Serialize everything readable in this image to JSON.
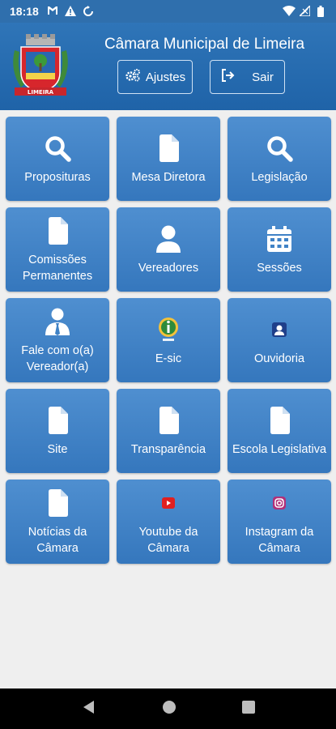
{
  "status_bar": {
    "time": "18:18",
    "left_icons": [
      "gmail-icon",
      "warning-icon",
      "sync-icon"
    ],
    "right_icons": [
      "wifi-icon",
      "signal-icon",
      "battery-icon"
    ]
  },
  "header": {
    "title": "Câmara Municipal de Limeira",
    "settings_label": "Ajustes",
    "exit_label": "Sair",
    "logo_text": "LIMEIRA"
  },
  "tiles": [
    {
      "label": "Proposituras",
      "icon": "search-icon"
    },
    {
      "label": "Mesa Diretora",
      "icon": "document-icon"
    },
    {
      "label": "Legislação",
      "icon": "search-icon"
    },
    {
      "label": "Comissões Permanentes",
      "icon": "document-icon"
    },
    {
      "label": "Vereadores",
      "icon": "user-icon"
    },
    {
      "label": "Sessões",
      "icon": "calendar-icon"
    },
    {
      "label": "Fale com o(a) Vereador(a)",
      "icon": "person-tie-icon"
    },
    {
      "label": "E-sic",
      "icon": "info-icon"
    },
    {
      "label": "Ouvidoria",
      "icon": "ouvidoria-icon"
    },
    {
      "label": "Site",
      "icon": "document-icon"
    },
    {
      "label": "Transparência",
      "icon": "document-icon"
    },
    {
      "label": "Escola Legislativa",
      "icon": "document-icon"
    },
    {
      "label": "Notícias da Câmara",
      "icon": "document-icon"
    },
    {
      "label": "Youtube da Câmara",
      "icon": "youtube-icon"
    },
    {
      "label": "Instagram da Câmara",
      "icon": "instagram-icon"
    }
  ],
  "nav_bar": {
    "buttons": [
      "back-icon",
      "home-icon",
      "recents-icon"
    ]
  }
}
